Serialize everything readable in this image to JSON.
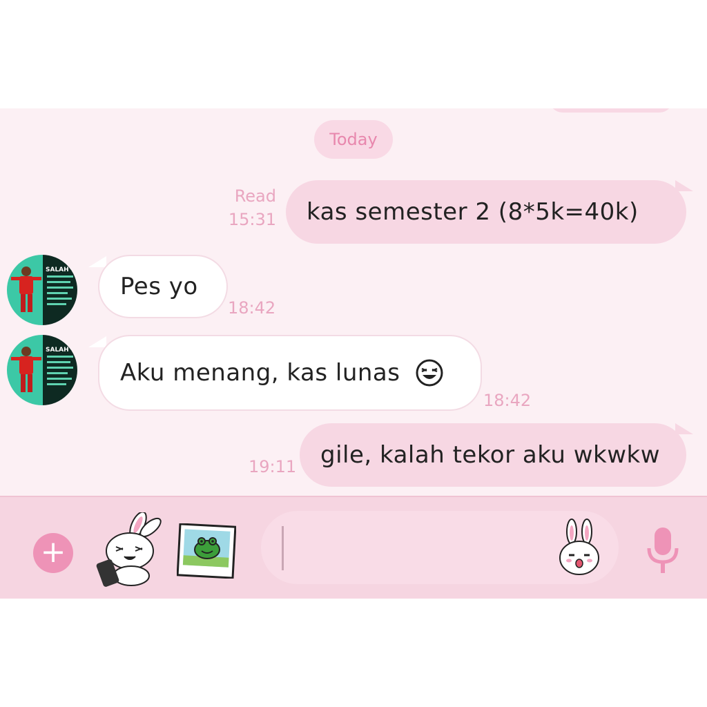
{
  "date_separator": "Today",
  "messages": [
    {
      "direction": "outgoing",
      "text": "kas semester 2 (8*5k=40k)",
      "status": "Read",
      "time": "15:31"
    },
    {
      "direction": "incoming",
      "text": "Pes yo",
      "time": "18:42"
    },
    {
      "direction": "incoming",
      "text": "Aku menang, kas lunas",
      "emoji": "laughing-face-emoji",
      "time": "18:42"
    },
    {
      "direction": "outgoing",
      "text": "gile, kalah tekor aku wkwkw",
      "time": "19:11"
    }
  ],
  "avatar": {
    "icon": "footballer-avatar",
    "text": "SALAH TO"
  },
  "input_bar": {
    "plus_icon": "plus-icon",
    "plus_glyph": "+",
    "sticker_icon": "bunny-sticker-icon",
    "gallery_icon": "frog-photo-gallery-icon",
    "emoji_icon": "bunny-emoji-icon",
    "mic_icon": "microphone-icon",
    "input_value": ""
  },
  "colors": {
    "chat_background": "#fcf0f4",
    "outgoing_bubble": "#f7d7e3",
    "incoming_bubble": "#ffffff",
    "accent": "#ee93b7",
    "timestamp": "#e9a6c0"
  }
}
